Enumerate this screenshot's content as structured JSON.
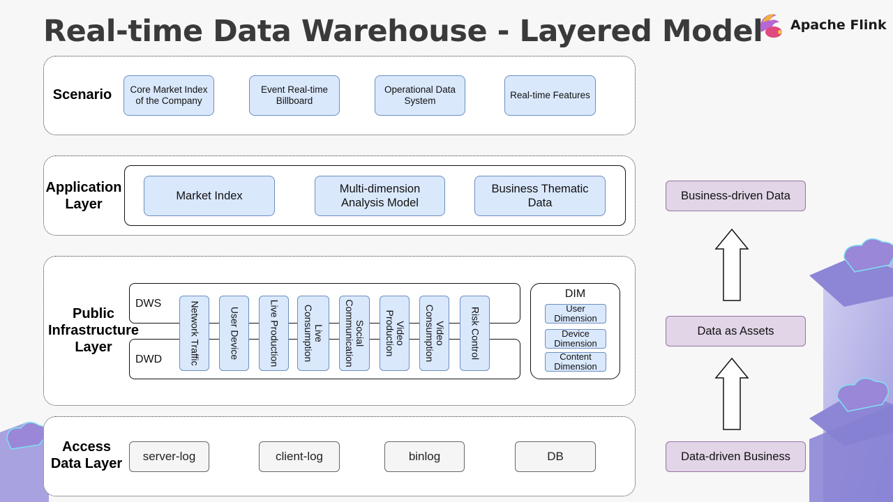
{
  "title": "Real-time Data Warehouse - Layered Model",
  "brand": {
    "name": "Apache Flink",
    "icon": "flink-squirrel-logo"
  },
  "layers": {
    "scenario": {
      "label": "Scenario",
      "items": [
        "Core Market Index\nof the Company",
        "Event Real-time\nBillboard",
        "Operational Data\nSystem",
        "Real-time Features"
      ]
    },
    "application": {
      "label": "Application\nLayer",
      "items": [
        "Market Index",
        "Multi-dimension\nAnalysis Model",
        "Business Thematic\nData"
      ]
    },
    "public": {
      "label": "Public\nInfrastructure\nLayer",
      "dws_label": "DWS",
      "dwd_label": "DWD",
      "subjects": [
        "Network Traffic",
        "User Device",
        "Live Production",
        "Live\nConsumption",
        "Social\nCommunication",
        "Video\nProduction",
        "Video\nConsumption",
        "Risk Control"
      ],
      "dim": {
        "title": "DIM",
        "items": [
          "User\nDimension",
          "Device\nDimension",
          "Content\nDimension"
        ]
      }
    },
    "access": {
      "label": "Access\nData Layer",
      "items": [
        "server-log",
        "client-log",
        "binlog",
        "DB"
      ]
    }
  },
  "value_flow": {
    "items": [
      "Business-driven Data",
      "Data as Assets",
      "Data-driven Business"
    ],
    "arrow_icon": "up-arrow-icon"
  },
  "colors": {
    "blue_fill": "#dae8fc",
    "blue_border": "#6c8ebf",
    "purple_fill": "#e1d5e7",
    "purple_border": "#9673a6",
    "gray_fill": "#f5f5f5"
  }
}
